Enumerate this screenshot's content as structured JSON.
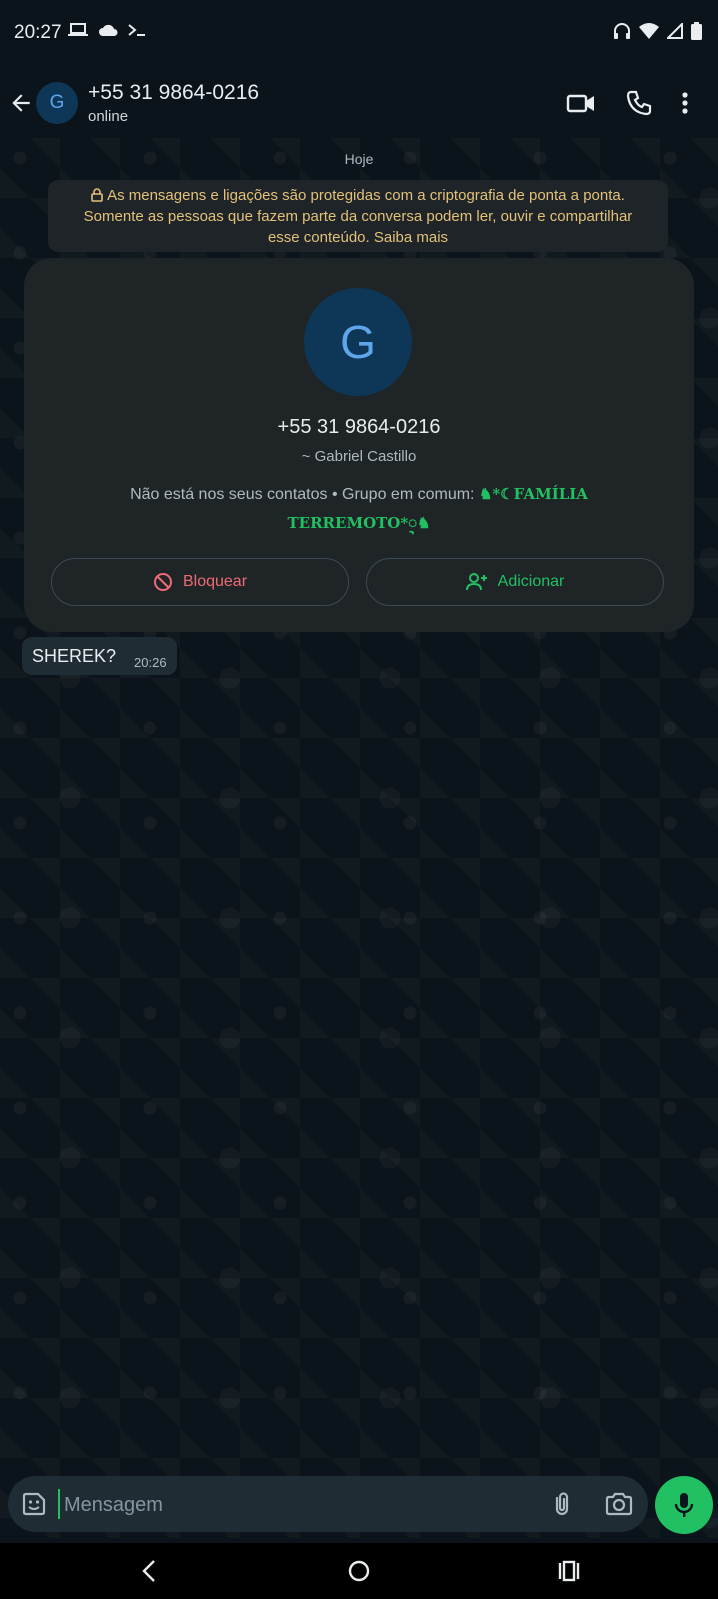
{
  "status_bar": {
    "time": "20:27"
  },
  "header": {
    "avatar_letter": "G",
    "contact_name": "+55 31 9864-0216",
    "status": "online"
  },
  "chat": {
    "date_label": "Hoje",
    "encryption_notice": "As mensagens e ligações são protegidas com a criptografia de ponta a ponta. Somente as pessoas que fazem parte da conversa podem ler, ouvir e compartilhar esse conteúdo. Saiba mais",
    "contact_card": {
      "avatar_letter": "G",
      "number": "+55 31 9864-0216",
      "name": "~ Gabriel Castillo",
      "info_prefix": "Não está nos seus contatos • Grupo em comum: ",
      "group_name": "♞*☾FAMÍLIA TERREMOTO*ᢩ♞",
      "block_label": "Bloquear",
      "add_label": "Adicionar"
    },
    "messages": [
      {
        "text": "SHEREK?",
        "time": "20:26"
      }
    ]
  },
  "input": {
    "placeholder": "Mensagem"
  },
  "colors": {
    "accent": "#21c063",
    "danger": "#ef6a74",
    "notice_text": "#e3c179",
    "background": "#0b141a"
  },
  "icons": {
    "status_bar": [
      "laptop-icon",
      "cloud-icon",
      "terminal-icon",
      "headset-icon",
      "wifi-icon",
      "signal-icon",
      "battery-icon"
    ],
    "header": [
      "back-arrow-icon",
      "video-call-icon",
      "voice-call-icon",
      "more-options-icon"
    ],
    "input": [
      "emoji-icon",
      "attach-icon",
      "camera-icon",
      "mic-icon"
    ],
    "nav": [
      "nav-back-icon",
      "nav-home-icon",
      "nav-recents-icon"
    ]
  }
}
